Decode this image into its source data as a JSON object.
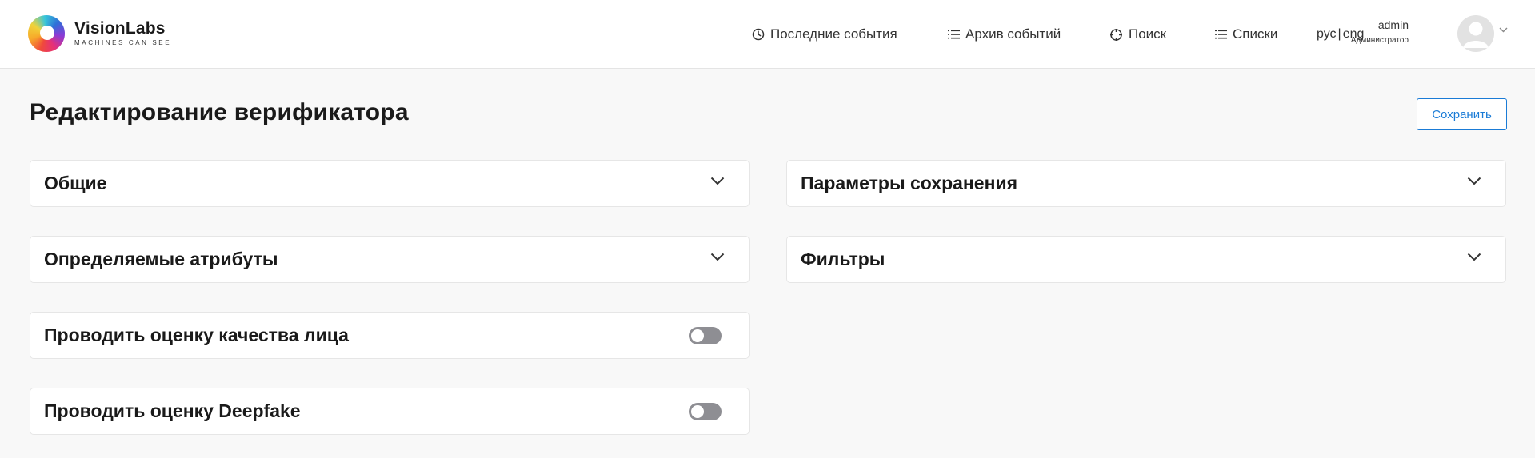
{
  "brand": {
    "name": "VisionLabs",
    "tagline": "MACHINES CAN SEE"
  },
  "nav": {
    "recent_events": "Последние события",
    "event_archive": "Архив событий",
    "search": "Поиск",
    "lists": "Списки"
  },
  "lang": {
    "ru": "рус",
    "separator": "|",
    "en": "eng"
  },
  "user": {
    "name": "admin",
    "role": "Администратор"
  },
  "page": {
    "title": "Редактирование верификатора",
    "save_label": "Сохранить"
  },
  "sections": {
    "general": "Общие",
    "save_params": "Параметры сохранения",
    "attributes": "Определяемые атрибуты",
    "filters": "Фильтры",
    "face_quality": "Проводить оценку качества лица",
    "deepfake": "Проводить оценку Deepfake"
  },
  "toggles": {
    "face_quality_enabled": false,
    "deepfake_enabled": false
  },
  "colors": {
    "accent": "#1a7bd6",
    "toggle_off": "#8e8e93",
    "header_bg": "#ffffff",
    "page_bg": "#f8f8f8"
  },
  "icons": {
    "recent_events": "clock-icon",
    "event_archive": "list-icon",
    "search": "crosshair-icon",
    "lists": "list-icon",
    "user_menu": "chevron-down-icon",
    "section_expand": "chevron-down-icon"
  }
}
